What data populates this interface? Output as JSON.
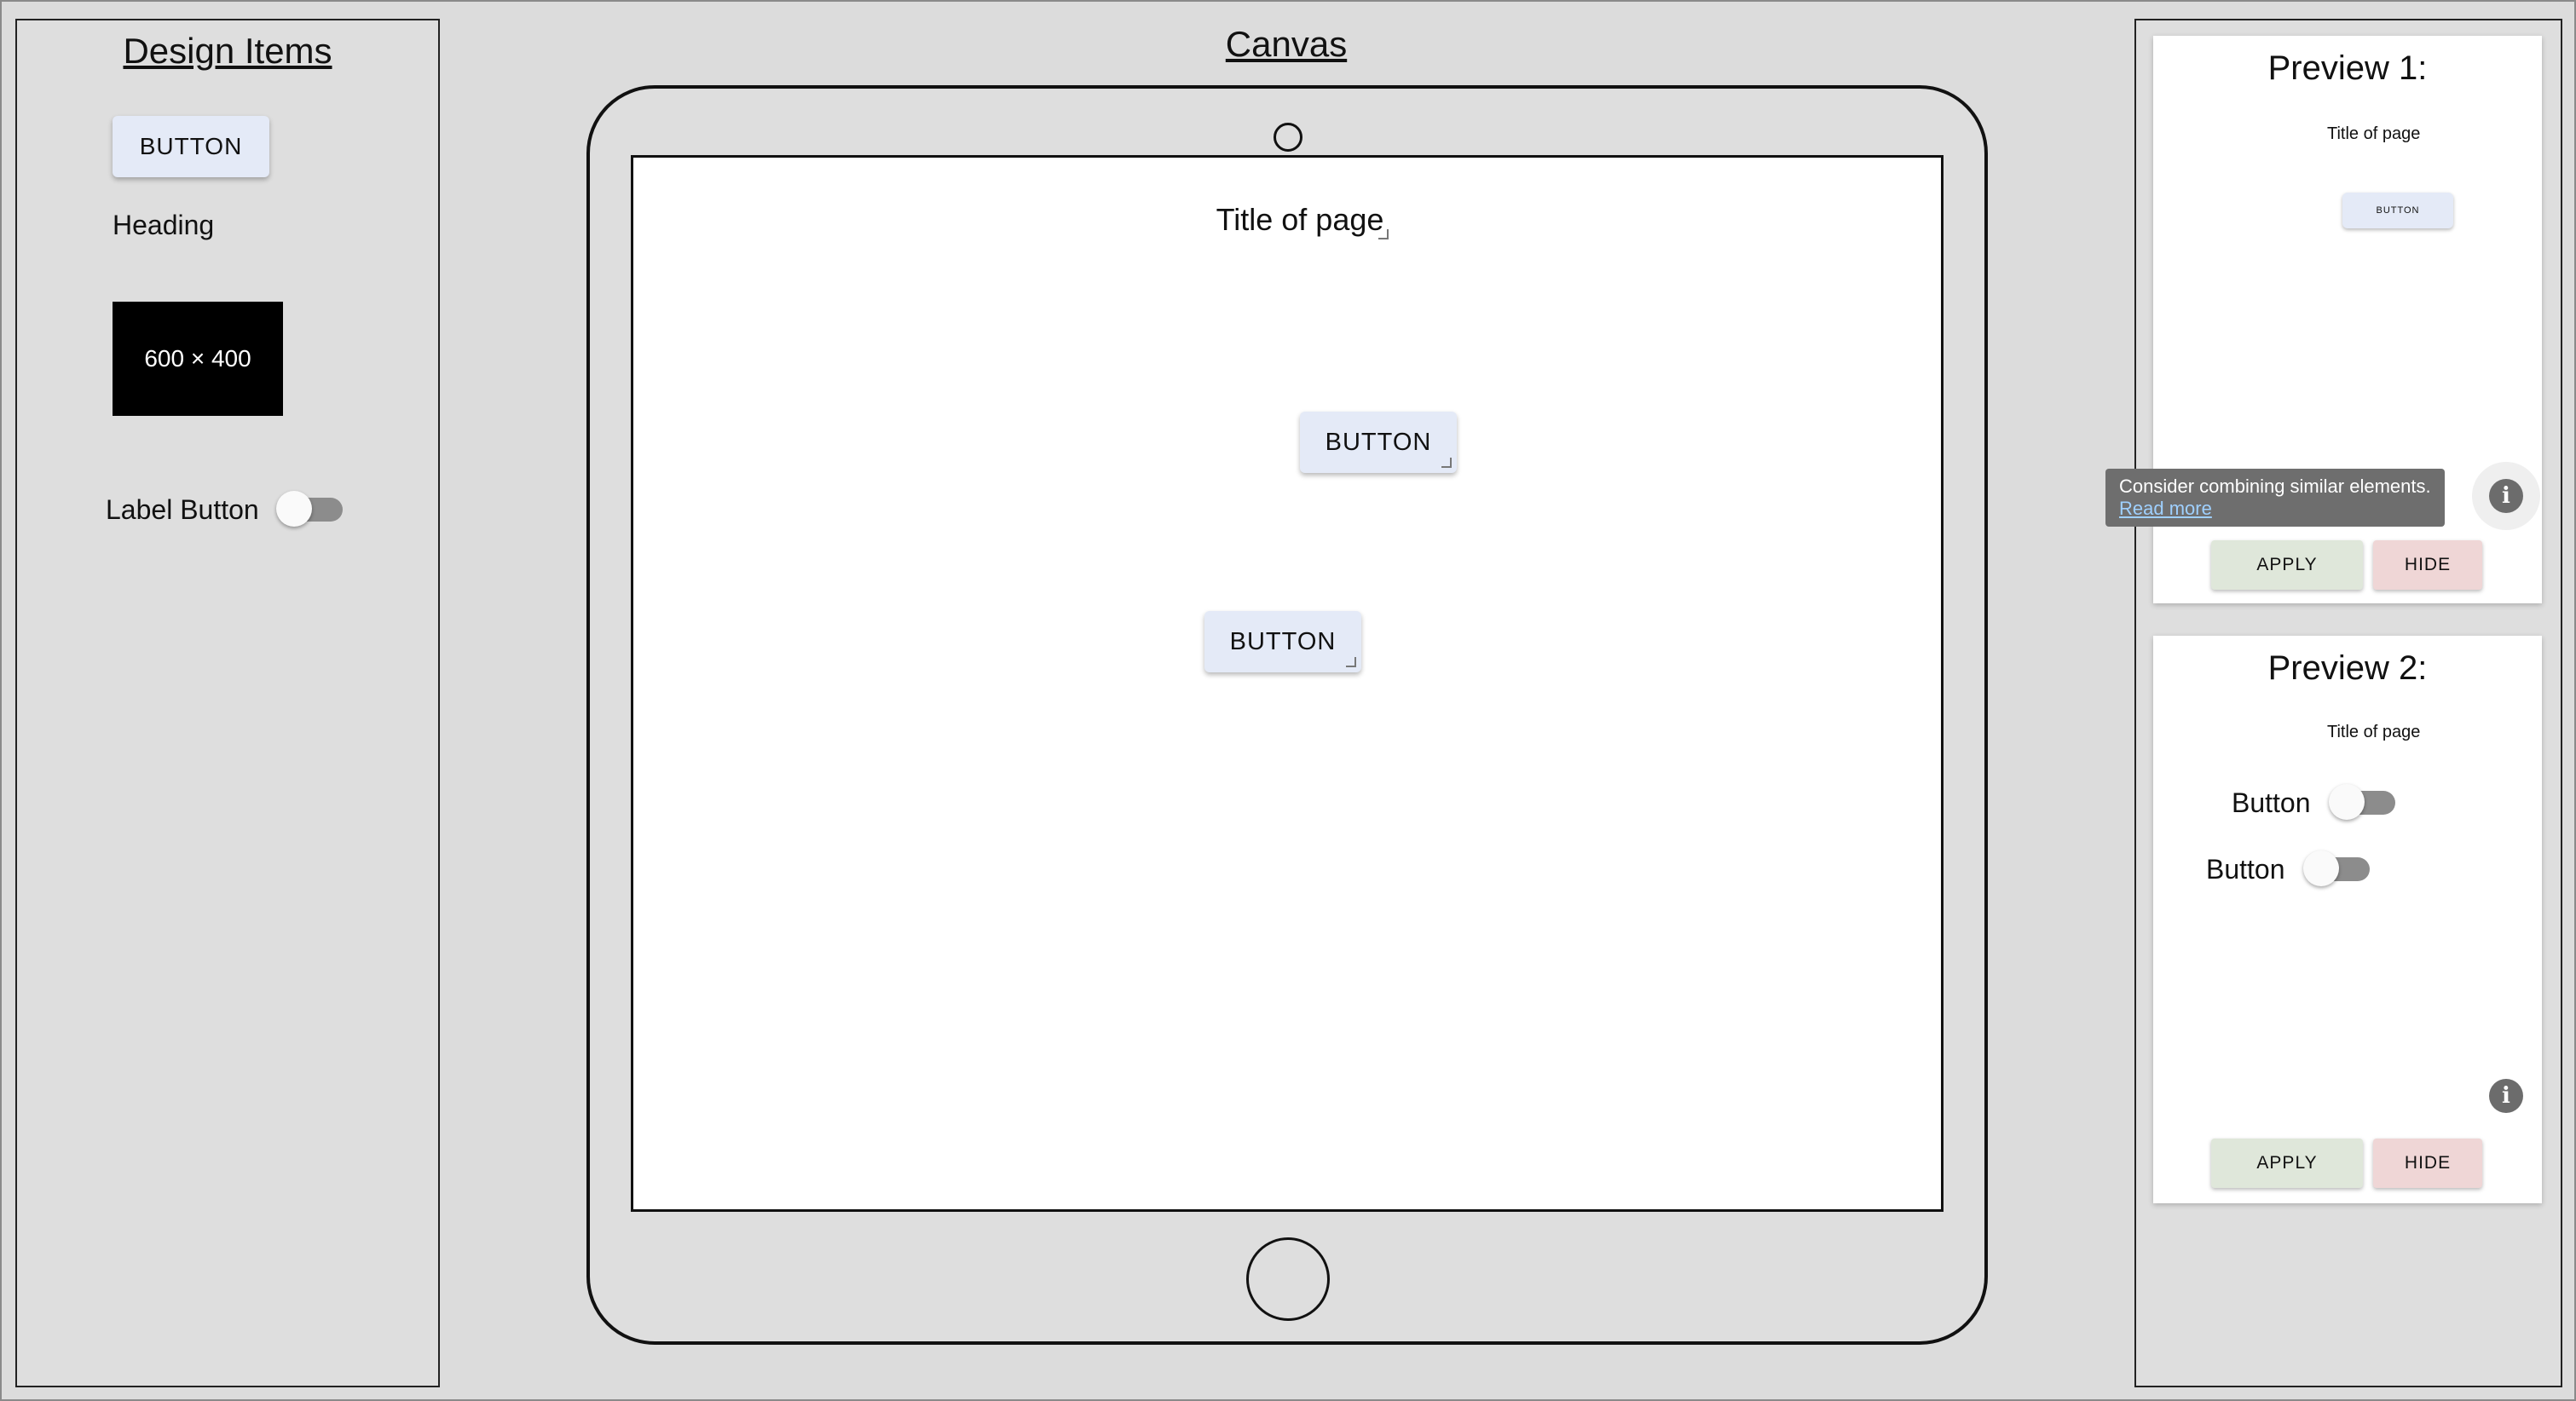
{
  "design_items": {
    "title": "Design Items",
    "button_label": "BUTTON",
    "heading_label": "Heading",
    "image_label": "600 × 400",
    "toggle_label": "Label Button"
  },
  "canvas": {
    "title": "Canvas",
    "page_title": "Title of page",
    "button1_label": "BUTTON",
    "button2_label": "BUTTON"
  },
  "preview1": {
    "title": "Preview 1:",
    "page_title": "Title of page",
    "button_label": "BUTTON",
    "tooltip_text": "Consider combining similar elements.",
    "tooltip_link": "Read more",
    "apply_label": "APPLY",
    "hide_label": "HIDE"
  },
  "preview2": {
    "title": "Preview 2:",
    "page_title": "Title of page",
    "toggle1_label": "Button",
    "toggle2_label": "Button",
    "apply_label": "APPLY",
    "hide_label": "HIDE"
  },
  "icons": {
    "info_icon": "info-icon",
    "info_glyph": "i"
  },
  "colors": {
    "background": "#dcdcdc",
    "button_bg": "#e4eaf7",
    "apply_bg": "#dfe7da",
    "hide_bg": "#efd6d6",
    "toggle_track": "#8c8c8c",
    "tooltip_bg": "#6e6e6e"
  }
}
